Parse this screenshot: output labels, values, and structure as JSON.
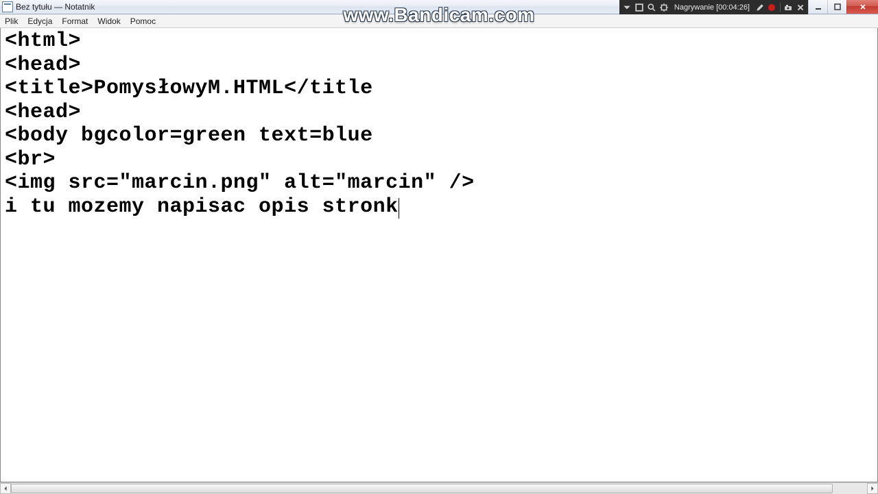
{
  "window": {
    "title": "Bez tytułu — Notatnik"
  },
  "menu": {
    "items": [
      "Plik",
      "Edycja",
      "Format",
      "Widok",
      "Pomoc"
    ]
  },
  "bandicam": {
    "label": "Nagrywanie",
    "time": "[00:04:26]",
    "watermark": "www.Bandicam.com"
  },
  "editor": {
    "lines": [
      "<html>",
      "<head>",
      "<title>PomysłowyM.HTML</title",
      "<head>",
      "<body bgcolor=green text=blue",
      "<br>",
      "<img src=\"marcin.png\" alt=\"marcin\" />",
      "i tu mozemy napisac opis stronk"
    ]
  }
}
